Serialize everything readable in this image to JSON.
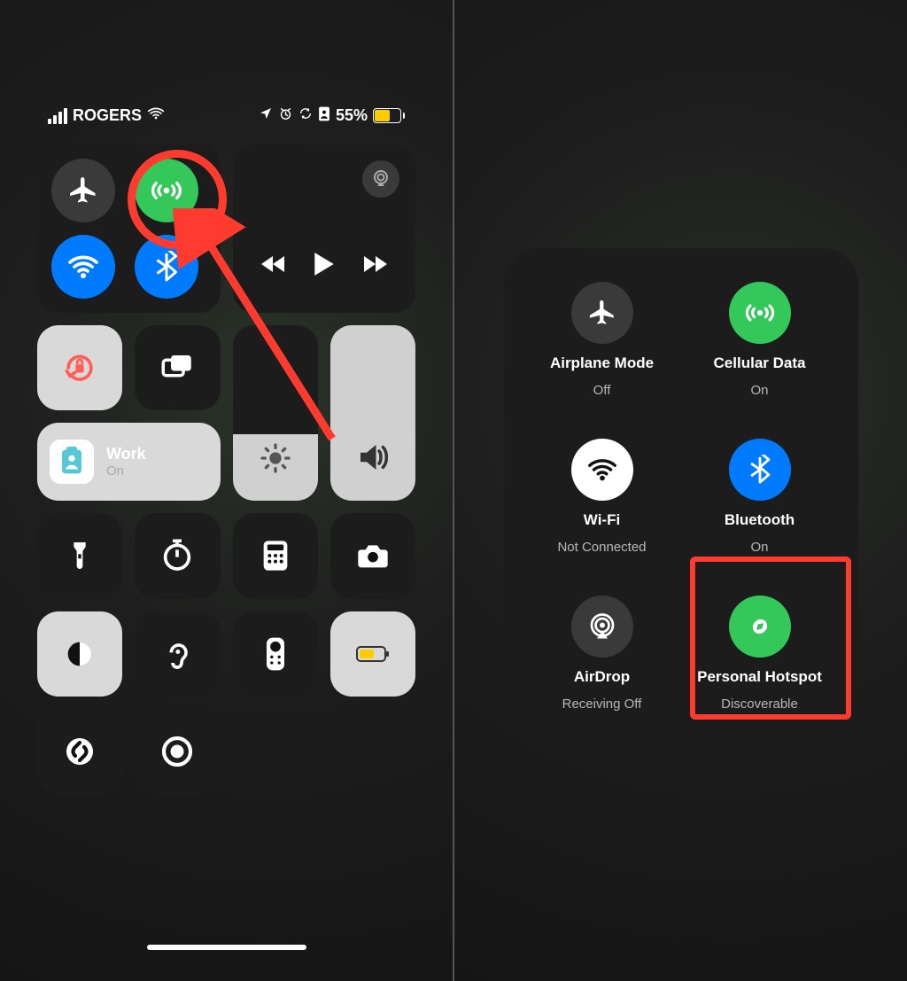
{
  "status": {
    "carrier": "ROGERS",
    "battery_text": "55%"
  },
  "connectivity": {
    "airplane": {
      "on": false
    },
    "cellular": {
      "on": true
    },
    "wifi": {
      "on": true
    },
    "bluetooth": {
      "on": true
    }
  },
  "focus": {
    "name": "Work",
    "state": "On"
  },
  "expanded": {
    "airplane": {
      "label": "Airplane Mode",
      "state": "Off"
    },
    "cellular": {
      "label": "Cellular Data",
      "state": "On"
    },
    "wifi": {
      "label": "Wi-Fi",
      "state": "Not Connected"
    },
    "bluetooth": {
      "label": "Bluetooth",
      "state": "On"
    },
    "airdrop": {
      "label": "AirDrop",
      "state": "Receiving Off"
    },
    "hotspot": {
      "label": "Personal Hotspot",
      "state": "Discoverable"
    }
  },
  "colors": {
    "green": "#34c759",
    "blue": "#007aff",
    "red": "#ff3b30",
    "yellow": "#ffcc00"
  }
}
